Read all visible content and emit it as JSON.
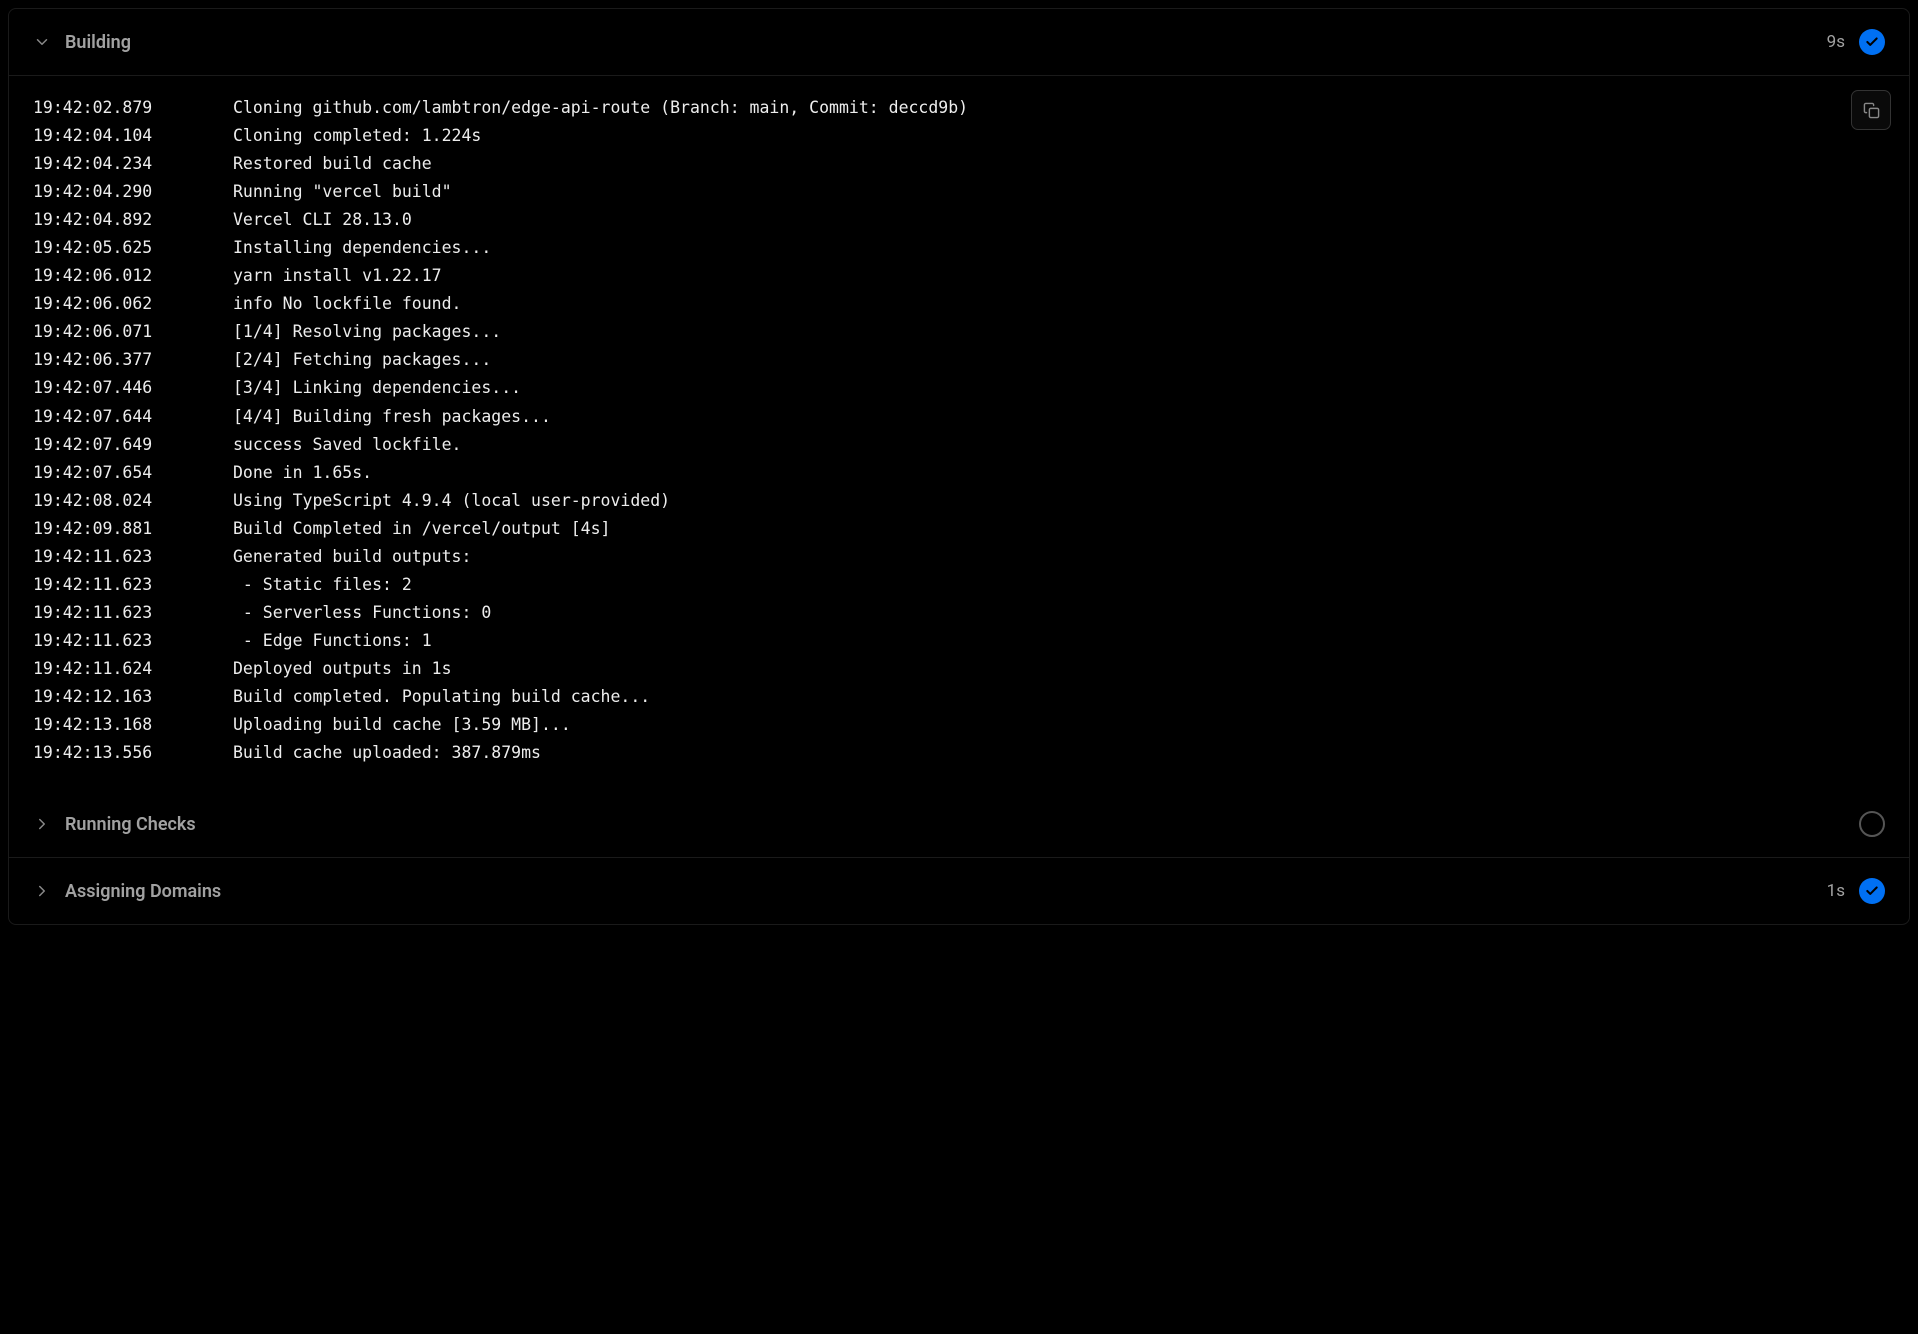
{
  "sections": {
    "building": {
      "title": "Building",
      "duration": "9s",
      "status": "success",
      "expanded": true
    },
    "runningChecks": {
      "title": "Running Checks",
      "status": "pending",
      "expanded": false
    },
    "assigningDomains": {
      "title": "Assigning Domains",
      "duration": "1s",
      "status": "success",
      "expanded": false
    }
  },
  "logs": [
    {
      "timestamp": "19:42:02.879",
      "message": "Cloning github.com/lambtron/edge-api-route (Branch: main, Commit: deccd9b)"
    },
    {
      "timestamp": "19:42:04.104",
      "message": "Cloning completed: 1.224s"
    },
    {
      "timestamp": "19:42:04.234",
      "message": "Restored build cache"
    },
    {
      "timestamp": "19:42:04.290",
      "message": "Running \"vercel build\""
    },
    {
      "timestamp": "19:42:04.892",
      "message": "Vercel CLI 28.13.0"
    },
    {
      "timestamp": "19:42:05.625",
      "message": "Installing dependencies..."
    },
    {
      "timestamp": "19:42:06.012",
      "message": "yarn install v1.22.17"
    },
    {
      "timestamp": "19:42:06.062",
      "message": "info No lockfile found."
    },
    {
      "timestamp": "19:42:06.071",
      "message": "[1/4] Resolving packages..."
    },
    {
      "timestamp": "19:42:06.377",
      "message": "[2/4] Fetching packages..."
    },
    {
      "timestamp": "19:42:07.446",
      "message": "[3/4] Linking dependencies..."
    },
    {
      "timestamp": "19:42:07.644",
      "message": "[4/4] Building fresh packages..."
    },
    {
      "timestamp": "19:42:07.649",
      "message": "success Saved lockfile."
    },
    {
      "timestamp": "19:42:07.654",
      "message": "Done in 1.65s."
    },
    {
      "timestamp": "19:42:08.024",
      "message": "Using TypeScript 4.9.4 (local user-provided)"
    },
    {
      "timestamp": "19:42:09.881",
      "message": "Build Completed in /vercel/output [4s]"
    },
    {
      "timestamp": "19:42:11.623",
      "message": "Generated build outputs:"
    },
    {
      "timestamp": "19:42:11.623",
      "message": " - Static files: 2"
    },
    {
      "timestamp": "19:42:11.623",
      "message": " - Serverless Functions: 0"
    },
    {
      "timestamp": "19:42:11.623",
      "message": " - Edge Functions: 1"
    },
    {
      "timestamp": "19:42:11.624",
      "message": "Deployed outputs in 1s"
    },
    {
      "timestamp": "19:42:12.163",
      "message": "Build completed. Populating build cache..."
    },
    {
      "timestamp": "19:42:13.168",
      "message": "Uploading build cache [3.59 MB]..."
    },
    {
      "timestamp": "19:42:13.556",
      "message": "Build cache uploaded: 387.879ms"
    }
  ]
}
